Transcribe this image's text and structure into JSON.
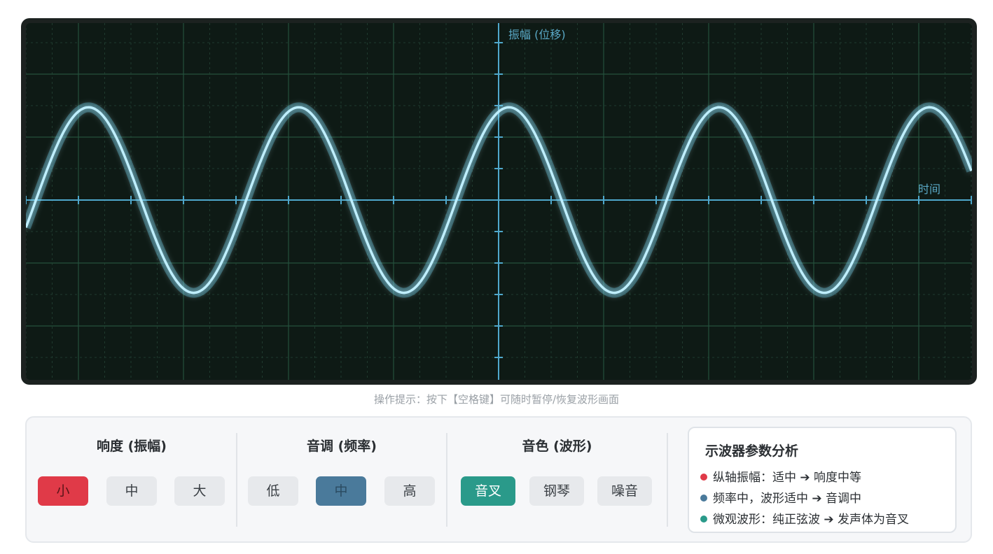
{
  "oscilloscope": {
    "y_axis_label": "振幅 (位移)",
    "x_axis_label": "时间",
    "wave": {
      "type": "sine",
      "cycles_visible": 4.5,
      "amplitude_fraction": 0.52,
      "color": "#bfefff",
      "glow": "#5ec8e6"
    }
  },
  "hint": "操作提示：按下【空格键】可随时暂停/恢复波形画面",
  "controls": {
    "loudness": {
      "title": "响度 (振幅)",
      "options": [
        "小",
        "中",
        "大"
      ],
      "selected": 0,
      "accent": "#e03a48"
    },
    "pitch": {
      "title": "音调 (频率)",
      "options": [
        "低",
        "中",
        "高"
      ],
      "selected": 1,
      "accent": "#4a7a9b"
    },
    "timbre": {
      "title": "音色 (波形)",
      "options": [
        "音叉",
        "钢琴",
        "噪音"
      ],
      "selected": 0,
      "accent": "#2a9a8a"
    }
  },
  "analysis": {
    "title": "示波器参数分析",
    "items": [
      {
        "text": "纵轴振幅：适中 ➔ 响度中等",
        "color": "#e03a48"
      },
      {
        "text": "频率中，波形适中 ➔ 音调中",
        "color": "#4a7a9b"
      },
      {
        "text": "微观波形：纯正弦波 ➔ 发声体为音叉",
        "color": "#2a9a8a"
      }
    ]
  }
}
